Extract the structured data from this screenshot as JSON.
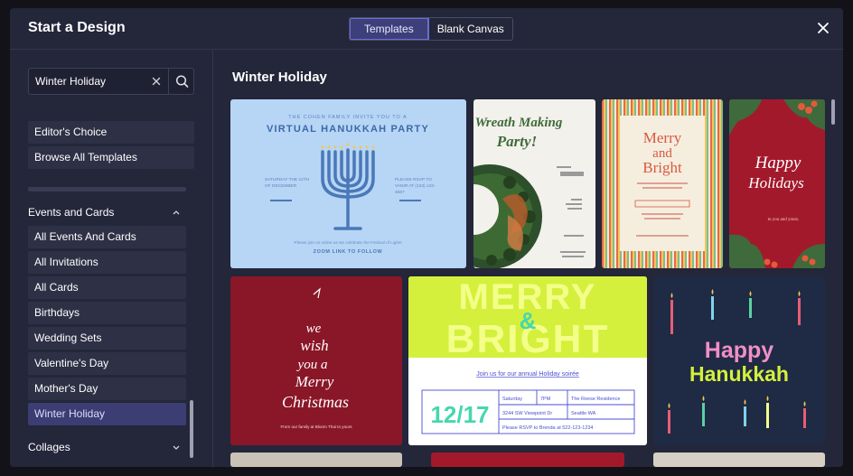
{
  "modal": {
    "title": "Start a Design",
    "tabs": {
      "templates": "Templates",
      "blank": "Blank Canvas"
    }
  },
  "sidebar": {
    "search_value": "Winter Holiday",
    "top_items": [
      "Editor's Choice",
      "Browse All Templates"
    ],
    "section_events": "Events and Cards",
    "event_items": [
      "All Events And Cards",
      "All Invitations",
      "All Cards",
      "Birthdays",
      "Wedding Sets",
      "Valentine's Day",
      "Mother's Day",
      "Winter Holiday"
    ],
    "selected": "Winter Holiday",
    "section_collages": "Collages"
  },
  "main": {
    "title": "Winter Holiday"
  },
  "templates": {
    "hanukkah_party": {
      "line1": "THE COHEN FAMILY INVITE YOU TO A",
      "title": "VIRTUAL HANUKKAH PARTY",
      "left": "SATURDAY THE 12TH OF DECEMBER",
      "right": "PLEASE RSVP TO VANIR AT (123) 123-4567",
      "note": "Please join us online as we celebrate the Festival of Lights",
      "link": "ZOOM LINK TO FOLLOW"
    },
    "wreath": {
      "title_1": "Wreath Making",
      "title_2": "Party!"
    },
    "merry_bright_stripes": {
      "line1": "Merry",
      "line2": "and",
      "line3": "Bright"
    },
    "happy_holidays": {
      "line1": "Happy",
      "line2": "Holidays",
      "sub": "to you and yours."
    },
    "wish_tree": {
      "line1": "we",
      "line2": "wish",
      "line3": "you a",
      "line4": "Merry",
      "line5": "Christmas",
      "footer": "From our family at Bloom Thai to yours"
    },
    "merry_bright_bold": {
      "line1": "MERRY",
      "amp": "&",
      "line2": "BRIGHT",
      "link": "Join us for our annual Holiday soirée",
      "date": "12/17",
      "cells": [
        "Saturday",
        "7PM",
        "The Reese Residence",
        "3244 SW Viewpoint Dr",
        "Seattle WA",
        "Please RSVP to Brenda at 522-123-1234"
      ]
    },
    "happy_hanukkah": {
      "line1": "Happy",
      "line2": "Hanukkah"
    }
  },
  "colors": {
    "modal_bg": "#24263a",
    "accent": "#3d3f7a",
    "hanukkah_blue": "#b7d5f5",
    "merry_green": "#d4f03c",
    "burgundy": "#8d1a2a",
    "navy": "#1f2a45"
  }
}
